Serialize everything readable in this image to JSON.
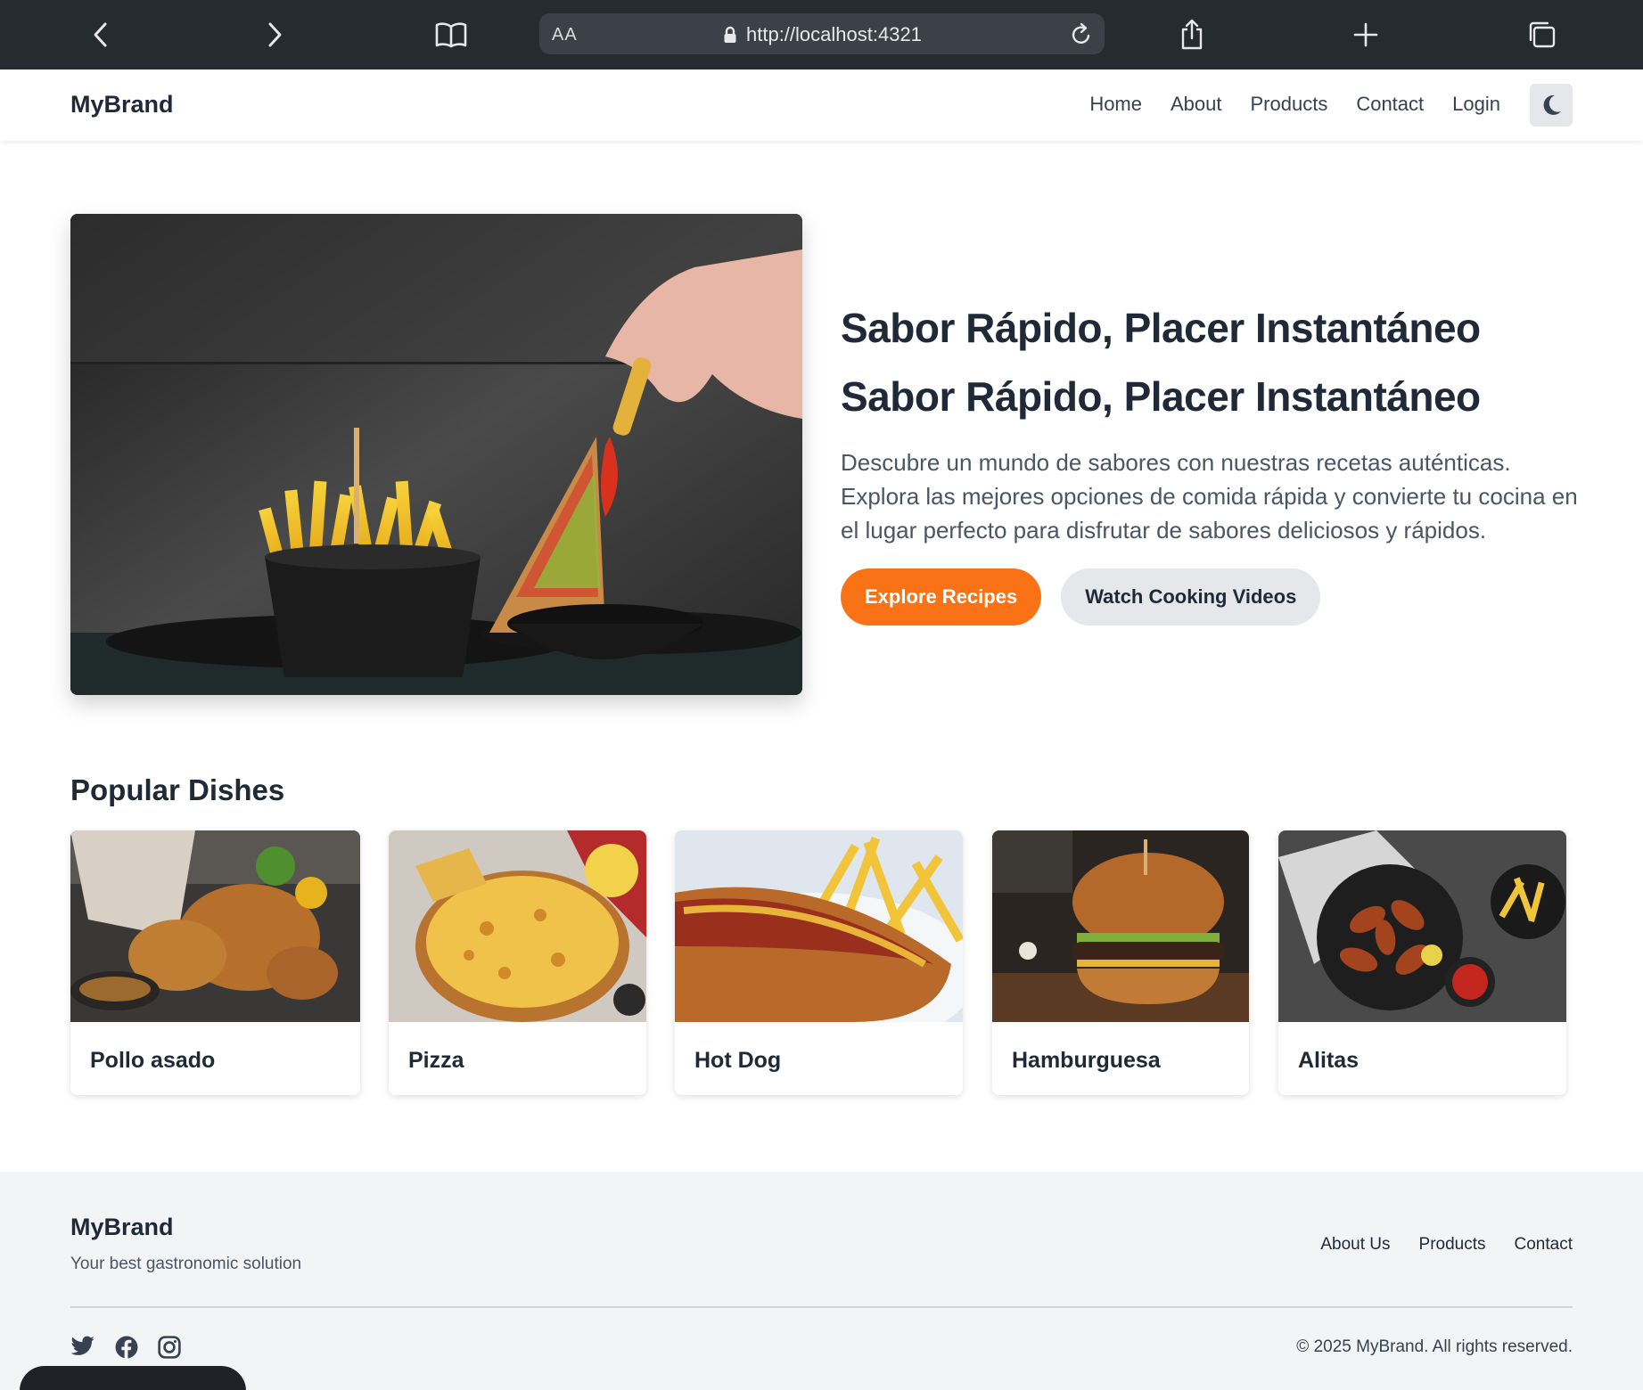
{
  "browser": {
    "font_size_label": "AA",
    "url": "http://localhost:4321"
  },
  "nav": {
    "brand": "MyBrand",
    "links": [
      "Home",
      "About",
      "Products",
      "Contact",
      "Login"
    ],
    "theme_icon": "moon-icon"
  },
  "hero": {
    "title_line1": "Sabor Rápido, Placer Instantáneo",
    "title_line2": "Sabor Rápido, Placer Instantáneo",
    "description": "Descubre un mundo de sabores con nuestras recetas auténticas. Explora las mejores opciones de comida rápida y convierte tu cocina en el lugar perfecto para disfrutar de sabores deliciosos y rápidos.",
    "primary_button": "Explore Recipes",
    "secondary_button": "Watch Cooking Videos"
  },
  "popular": {
    "title": "Popular Dishes",
    "dishes": [
      {
        "name": "Pollo asado"
      },
      {
        "name": "Pizza"
      },
      {
        "name": "Hot Dog"
      },
      {
        "name": "Hamburguesa"
      },
      {
        "name": "Alitas"
      }
    ]
  },
  "footer": {
    "brand": "MyBrand",
    "tagline": "Your best gastronomic solution",
    "links": [
      "About Us",
      "Products",
      "Contact"
    ],
    "social_icons": [
      "twitter-icon",
      "facebook-icon",
      "instagram-icon"
    ],
    "copyright": "© 2025 MyBrand. All rights reserved."
  },
  "colors": {
    "accent": "#f97316",
    "text_dark": "#1f2937",
    "chrome_bg": "#262a31",
    "footer_bg": "#f3f4f6"
  }
}
